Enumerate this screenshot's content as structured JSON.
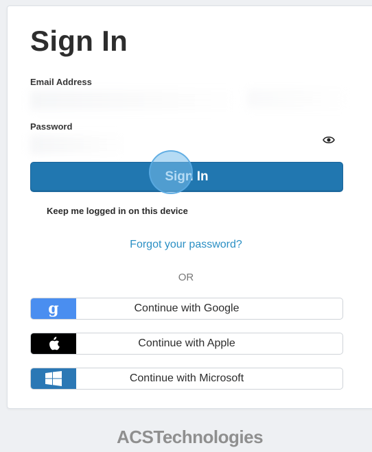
{
  "signin": {
    "title": "Sign In",
    "email_label": "Email Address",
    "password_label": "Password",
    "submit_label": "Sign In",
    "keep_logged_in_label": "Keep me logged in on this device",
    "forgot_password_label": "Forgot your password?",
    "or_label": "OR"
  },
  "sso": [
    {
      "label": "Continue with Google",
      "icon": "google-icon",
      "color": "#4a8ef0"
    },
    {
      "label": "Continue with Apple",
      "icon": "apple-icon",
      "color": "#000000"
    },
    {
      "label": "Continue with Microsoft",
      "icon": "windows-icon",
      "color": "#2b78b5"
    }
  ],
  "footer": {
    "logo_text": "ACSTechnologies"
  },
  "colors": {
    "primary": "#2177b0",
    "link": "#2a8fc4"
  }
}
